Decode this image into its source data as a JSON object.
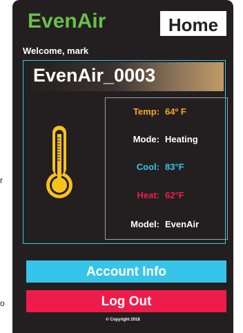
{
  "edge_text": {
    "left_mid": "r",
    "left_low": "o"
  },
  "header": {
    "brand": "EvenAir",
    "tab_label": "Home"
  },
  "welcome": "Welcome, mark",
  "device": {
    "name": "EvenAir_0003",
    "thermometer_icon": "thermometer-icon",
    "rows": [
      {
        "label": "Temp:",
        "value": "64º F",
        "color": "#f5a623"
      },
      {
        "label": "Mode:",
        "value": "Heating",
        "color": "#ffffff"
      },
      {
        "label": "Cool:",
        "value": "83°F",
        "color": "#36c4e9"
      },
      {
        "label": "Heat:",
        "value": "62°F",
        "color": "#ef1b49"
      },
      {
        "label": "Model:",
        "value": "EvenAir",
        "color": "#ffffff"
      }
    ]
  },
  "buttons": {
    "account": "Account Info",
    "logout": "Log Out"
  },
  "copyright": "© Copyright 2018",
  "colors": {
    "background": "#231f20",
    "brand_green": "#6abf4b",
    "accent_cyan": "#36c4e9",
    "accent_red": "#ef1b49",
    "thermometer_yellow": "#f7c21c"
  }
}
